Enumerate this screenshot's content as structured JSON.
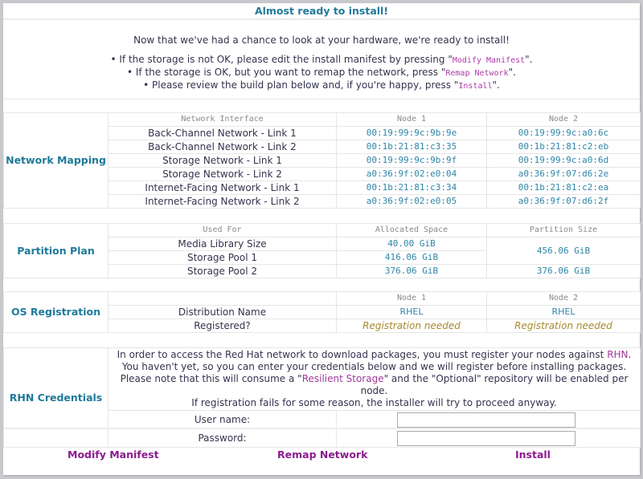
{
  "title": "Almost ready to install!",
  "intro": {
    "lead": "Now that we've had a chance to look at your hardware, we're ready to install!",
    "bullets": [
      {
        "pre": "• If the storage is not OK, please edit the install manifest by pressing \"",
        "code": "Modify Manifest",
        "post": "\"."
      },
      {
        "pre": "• If the storage is OK, but you want to remap the network, press \"",
        "code": "Remap Network",
        "post": "\"."
      },
      {
        "pre": "• Please review the build plan below and, if you're happy, press \"",
        "code": "Install",
        "post": "\"."
      }
    ]
  },
  "network_mapping": {
    "section_label": "Network Mapping",
    "headers": [
      "Network Interface",
      "Node 1",
      "Node 2"
    ],
    "rows": [
      {
        "name": "Back-Channel Network - Link 1",
        "node1": "00:19:99:9c:9b:9e",
        "node2": "00:19:99:9c:a0:6c"
      },
      {
        "name": "Back-Channel Network - Link 2",
        "node1": "00:1b:21:81:c3:35",
        "node2": "00:1b:21:81:c2:eb"
      },
      {
        "name": "Storage Network - Link 1",
        "node1": "00:19:99:9c:9b:9f",
        "node2": "00:19:99:9c:a0:6d"
      },
      {
        "name": "Storage Network - Link 2",
        "node1": "a0:36:9f:02:e0:04",
        "node2": "a0:36:9f:07:d6:2e"
      },
      {
        "name": "Internet-Facing Network - Link 1",
        "node1": "00:1b:21:81:c3:34",
        "node2": "00:1b:21:81:c2:ea"
      },
      {
        "name": "Internet-Facing Network - Link 2",
        "node1": "a0:36:9f:02:e0:05",
        "node2": "a0:36:9f:07:d6:2f"
      }
    ]
  },
  "partition_plan": {
    "section_label": "Partition Plan",
    "headers": [
      "Used For",
      "Allocated Space",
      "Partition Size"
    ],
    "rows": [
      {
        "used_for": "Media Library Size",
        "allocated": "40.00 GiB"
      },
      {
        "used_for": "Storage Pool 1",
        "allocated": "416.06 GiB"
      },
      {
        "used_for": "Storage Pool 2",
        "allocated": "376.06 GiB"
      }
    ],
    "partition_sizes": [
      "456.06 GiB",
      "376.06 GiB"
    ]
  },
  "os_registration": {
    "section_label": "OS Registration",
    "headers": [
      "",
      "Node 1",
      "Node 2"
    ],
    "rows": [
      {
        "label": "Distribution Name",
        "node1": "RHEL",
        "node2": "RHEL"
      },
      {
        "label": "Registered?",
        "node1": "Registration needed",
        "node2": "Registration needed"
      }
    ]
  },
  "rhn": {
    "section_label": "RHN Credentials",
    "line1_pre": "In order to access the Red Hat network to download packages, you must register your nodes against ",
    "line1_link": "RHN",
    "line1_post": ".",
    "line2": "You haven't yet, so you can enter your credentials below and we will register before installing packages.",
    "line3_pre": "Please note that this will consume a \"",
    "line3_link": "Resilient Storage",
    "line3_post": "\" and the \"Optional\" repository will be enabled per node.",
    "line4": "If registration fails for some reason, the installer will try to proceed anyway.",
    "username_label": "User name:",
    "username_value": "",
    "password_label": "Password:",
    "password_value": ""
  },
  "actions": {
    "modify": "Modify Manifest",
    "remap": "Remap Network",
    "install": "Install"
  }
}
